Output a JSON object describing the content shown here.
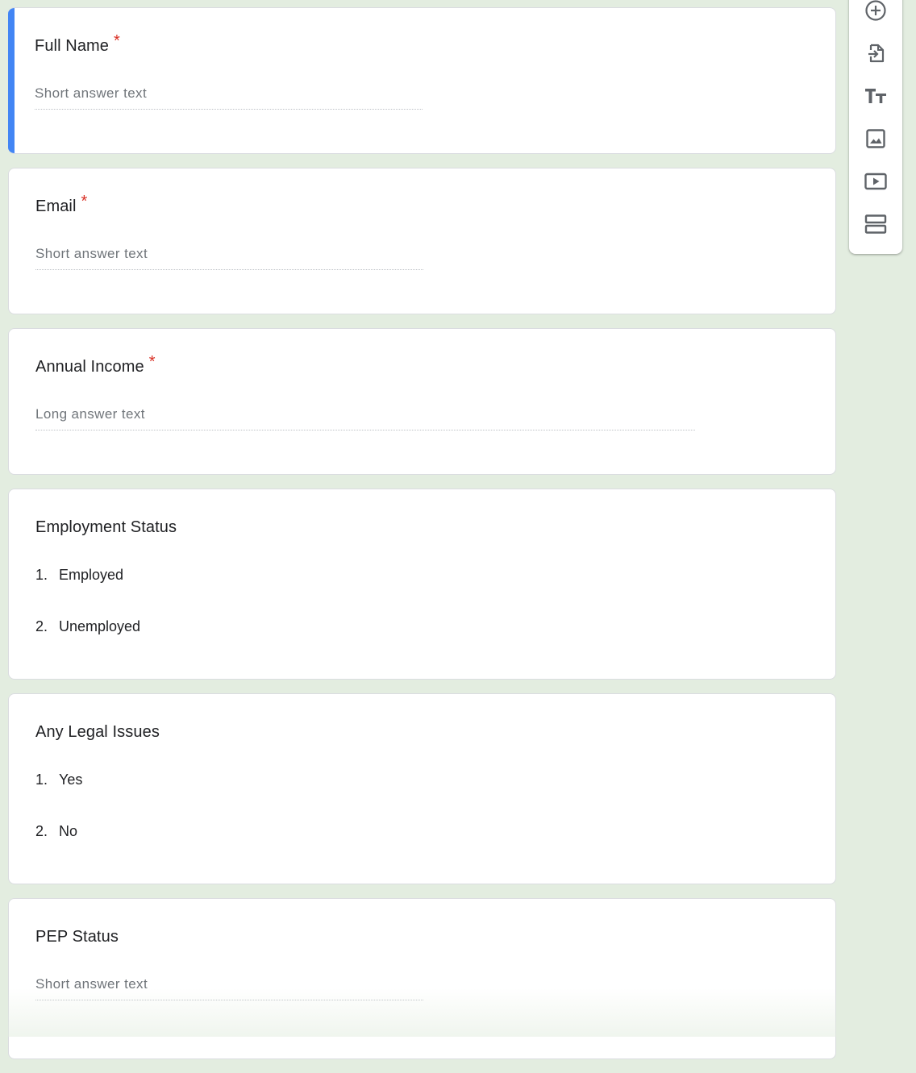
{
  "questions": [
    {
      "title": "Full Name",
      "required_mark": "*",
      "answer_placeholder": "Short answer text"
    },
    {
      "title": "Email",
      "required_mark": "*",
      "answer_placeholder": "Short answer text"
    },
    {
      "title": "Annual Income",
      "required_mark": "*",
      "answer_placeholder": "Long answer text"
    },
    {
      "title": "Employment Status",
      "options": [
        {
          "num": "1.",
          "label": "Employed"
        },
        {
          "num": "2.",
          "label": "Unemployed"
        }
      ]
    },
    {
      "title": "Any Legal Issues",
      "options": [
        {
          "num": "1.",
          "label": "Yes"
        },
        {
          "num": "2.",
          "label": "No"
        }
      ]
    },
    {
      "title": "PEP Status",
      "answer_placeholder": "Short answer text"
    }
  ],
  "toolbar": {
    "tools": [
      {
        "icon": "add-circle-icon"
      },
      {
        "icon": "import-questions-icon"
      },
      {
        "icon": "title-text-icon"
      },
      {
        "icon": "image-icon"
      },
      {
        "icon": "video-icon"
      },
      {
        "icon": "section-icon"
      }
    ]
  },
  "colors": {
    "background": "#e3ede0",
    "accent": "#4285f4",
    "required": "#d93025",
    "icon": "#5f6368"
  }
}
